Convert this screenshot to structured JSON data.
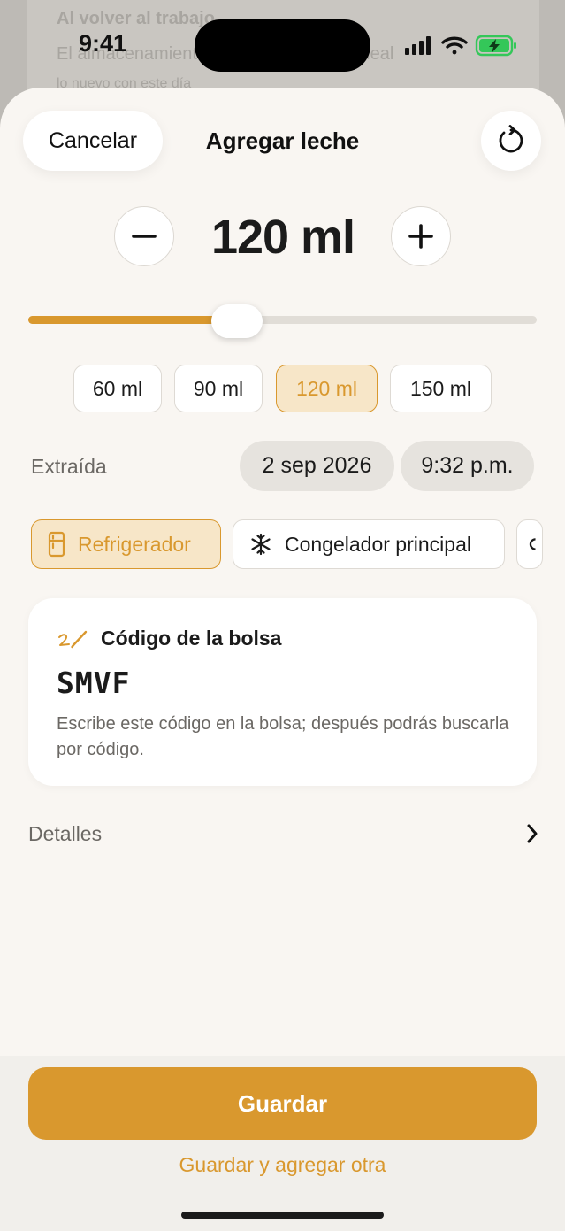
{
  "background_page": {
    "line1": "Al volver al trabajo",
    "line2": "El almacenamiento en refrigerador es ideal",
    "line3": "lo nuevo con este día"
  },
  "status_bar": {
    "time": "9:41"
  },
  "header": {
    "cancel_label": "Cancelar",
    "title": "Agregar leche",
    "reset_icon": "arrow-counterclockwise-icon"
  },
  "amount": {
    "value": "120 ml",
    "slider_fraction": 0.41
  },
  "presets": [
    {
      "label": "60 ml",
      "selected": false
    },
    {
      "label": "90 ml",
      "selected": false
    },
    {
      "label": "120 ml",
      "selected": true
    },
    {
      "label": "150 ml",
      "selected": false
    }
  ],
  "extraction": {
    "label": "Extraída",
    "date": "2 sep 2026",
    "time": "9:32 p.m."
  },
  "locations": [
    {
      "label": "Refrigerador",
      "icon": "refrigerator-icon",
      "selected": true
    },
    {
      "label": "Congelador principal",
      "icon": "snowflake-icon",
      "selected": false
    }
  ],
  "bag_code": {
    "title": "Código de la bolsa",
    "icon": "pencil-scribble-icon",
    "code": "SMVF",
    "hint": "Escribe este código en la bolsa; después podrás buscarla por código."
  },
  "details": {
    "label": "Detalles"
  },
  "footer": {
    "save_label": "Guardar",
    "save_another_label": "Guardar y agregar otra"
  },
  "colors": {
    "accent": "#d9982e",
    "accent_soft": "#f7e6c8",
    "sheet_bg": "#f9f6f2"
  }
}
